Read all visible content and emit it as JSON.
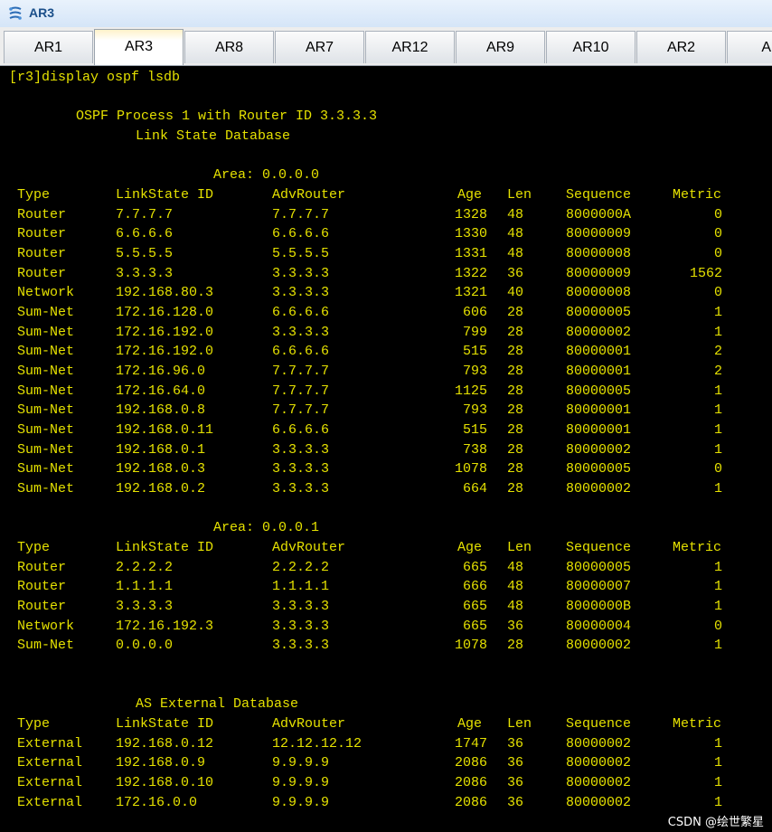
{
  "window": {
    "title": "AR3",
    "icon": "network-device-icon"
  },
  "tabs": [
    "AR1",
    "AR3",
    "AR8",
    "AR7",
    "AR12",
    "AR9",
    "AR10",
    "AR2",
    "AR"
  ],
  "active_tab": "AR3",
  "terminal": {
    "command": "[r3]display ospf lsdb",
    "process_line": "OSPF Process 1 with Router ID 3.3.3.3",
    "db_title": "Link State Database",
    "headers": [
      "Type",
      "LinkState ID",
      "AdvRouter",
      "Age",
      "Len",
      "Sequence",
      "Metric"
    ],
    "areas": [
      {
        "label": "Area: 0.0.0.0",
        "rows": [
          [
            "Router",
            "7.7.7.7",
            "7.7.7.7",
            "1328",
            "48",
            "8000000A",
            "0"
          ],
          [
            "Router",
            "6.6.6.6",
            "6.6.6.6",
            "1330",
            "48",
            "80000009",
            "0"
          ],
          [
            "Router",
            "5.5.5.5",
            "5.5.5.5",
            "1331",
            "48",
            "80000008",
            "0"
          ],
          [
            "Router",
            "3.3.3.3",
            "3.3.3.3",
            "1322",
            "36",
            "80000009",
            "1562"
          ],
          [
            "Network",
            "192.168.80.3",
            "3.3.3.3",
            "1321",
            "40",
            "80000008",
            "0"
          ],
          [
            "Sum-Net",
            "172.16.128.0",
            "6.6.6.6",
            "606",
            "28",
            "80000005",
            "1"
          ],
          [
            "Sum-Net",
            "172.16.192.0",
            "3.3.3.3",
            "799",
            "28",
            "80000002",
            "1"
          ],
          [
            "Sum-Net",
            "172.16.192.0",
            "6.6.6.6",
            "515",
            "28",
            "80000001",
            "2"
          ],
          [
            "Sum-Net",
            "172.16.96.0",
            "7.7.7.7",
            "793",
            "28",
            "80000001",
            "2"
          ],
          [
            "Sum-Net",
            "172.16.64.0",
            "7.7.7.7",
            "1125",
            "28",
            "80000005",
            "1"
          ],
          [
            "Sum-Net",
            "192.168.0.8",
            "7.7.7.7",
            "793",
            "28",
            "80000001",
            "1"
          ],
          [
            "Sum-Net",
            "192.168.0.11",
            "6.6.6.6",
            "515",
            "28",
            "80000001",
            "1"
          ],
          [
            "Sum-Net",
            "192.168.0.1",
            "3.3.3.3",
            "738",
            "28",
            "80000002",
            "1"
          ],
          [
            "Sum-Net",
            "192.168.0.3",
            "3.3.3.3",
            "1078",
            "28",
            "80000005",
            "0"
          ],
          [
            "Sum-Net",
            "192.168.0.2",
            "3.3.3.3",
            "664",
            "28",
            "80000002",
            "1"
          ]
        ]
      },
      {
        "label": "Area: 0.0.0.1",
        "rows": [
          [
            "Router",
            "2.2.2.2",
            "2.2.2.2",
            "665",
            "48",
            "80000005",
            "1"
          ],
          [
            "Router",
            "1.1.1.1",
            "1.1.1.1",
            "666",
            "48",
            "80000007",
            "1"
          ],
          [
            "Router",
            "3.3.3.3",
            "3.3.3.3",
            "665",
            "48",
            "8000000B",
            "1"
          ],
          [
            "Network",
            "172.16.192.3",
            "3.3.3.3",
            "665",
            "36",
            "80000004",
            "0"
          ],
          [
            "Sum-Net",
            "0.0.0.0",
            "3.3.3.3",
            "1078",
            "28",
            "80000002",
            "1"
          ]
        ]
      }
    ],
    "external": {
      "title": "AS External Database",
      "rows": [
        [
          "External",
          "192.168.0.12",
          "12.12.12.12",
          "1747",
          "36",
          "80000002",
          "1"
        ],
        [
          "External",
          "192.168.0.9",
          "9.9.9.9",
          "2086",
          "36",
          "80000002",
          "1"
        ],
        [
          "External",
          "192.168.0.10",
          "9.9.9.9",
          "2086",
          "36",
          "80000002",
          "1"
        ],
        [
          "External",
          "172.16.0.0",
          "9.9.9.9",
          "2086",
          "36",
          "80000002",
          "1"
        ]
      ]
    }
  },
  "watermark": "CSDN @绘世繁星",
  "colors": {
    "terminal_text": "#e5e100",
    "terminal_bg": "#000000",
    "title_text": "#1b4f8a"
  }
}
